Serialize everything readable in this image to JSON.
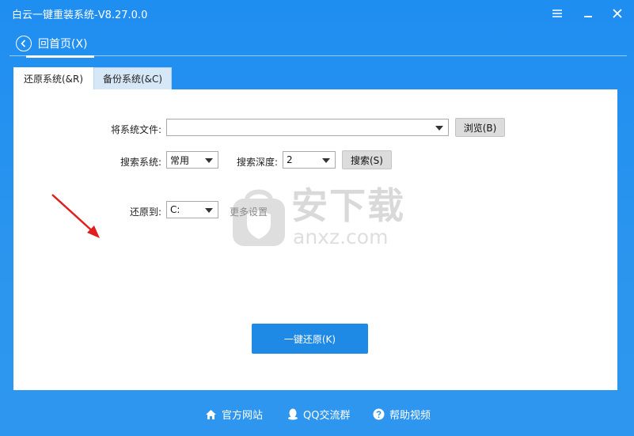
{
  "window": {
    "title": "白云一键重装系统-V8.27.0.0",
    "controls": {
      "settings_icon": "gear-icon",
      "minimize_icon": "minimize-icon",
      "close_icon": "close-icon"
    }
  },
  "header": {
    "back_label": "回首页(X)",
    "back_icon": "arrow-left-circle-icon"
  },
  "tabs": [
    {
      "label": "还原系统(&R)",
      "active": true
    },
    {
      "label": "备份系统(&C)",
      "active": false
    }
  ],
  "form": {
    "system_file_label": "将系统文件:",
    "system_file_value": "",
    "browse_button": "浏览(B)",
    "search_system_label": "搜索系统:",
    "search_system_value": "常用",
    "search_depth_label": "搜索深度:",
    "search_depth_value": "2",
    "search_button": "搜索(S)",
    "restore_to_label": "还原到:",
    "restore_to_value": "C:",
    "more_settings_link": "更多设置",
    "restore_button": "一键还原(K)"
  },
  "watermark": {
    "cn": "安下载",
    "en": "anxz.com"
  },
  "footer": [
    {
      "label": "官方网站",
      "icon": "home-icon"
    },
    {
      "label": "QQ交流群",
      "icon": "qq-penguin-icon"
    },
    {
      "label": "帮助视频",
      "icon": "help-circle-icon"
    }
  ],
  "colors": {
    "window_blue": "#1f8ef1",
    "primary_button": "#1e8ae6",
    "annotation_arrow": "#e02020"
  }
}
